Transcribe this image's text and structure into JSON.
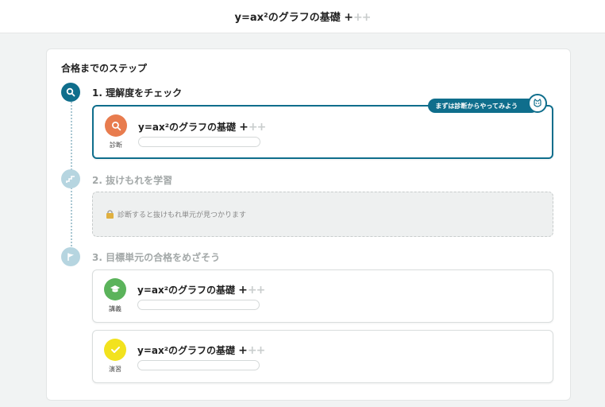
{
  "header": {
    "title": "y=ax²のグラフの基礎",
    "plus_dark": "+",
    "plus_light": "++"
  },
  "card": {
    "title": "合格までのステップ"
  },
  "steps": [
    {
      "label": "1. 理解度をチェック",
      "state": "active",
      "icon": "search-icon",
      "tooltip": "まずは診断からやってみよう",
      "unit": {
        "icon_label": "診断",
        "icon": "search-icon",
        "title": "y=ax²のグラフの基礎",
        "plus_dark": "+",
        "plus_light": "++",
        "color": "#e87c4e"
      }
    },
    {
      "label": "2. 抜けもれを学習",
      "state": "inactive",
      "icon": "stairs-icon",
      "locked_text": "診断すると抜けもれ単元が見つかります"
    },
    {
      "label": "3. 目標単元の合格をめざそう",
      "state": "inactive",
      "icon": "flag-icon",
      "units": [
        {
          "icon_label": "講義",
          "icon": "graduation-cap-icon",
          "title": "y=ax²のグラフの基礎",
          "plus_dark": "+",
          "plus_light": "++",
          "color": "#5bb35b"
        },
        {
          "icon_label": "演習",
          "icon": "check-icon",
          "title": "y=ax²のグラフの基礎",
          "plus_dark": "+",
          "plus_light": "++",
          "color": "#f2e21e"
        }
      ]
    }
  ]
}
